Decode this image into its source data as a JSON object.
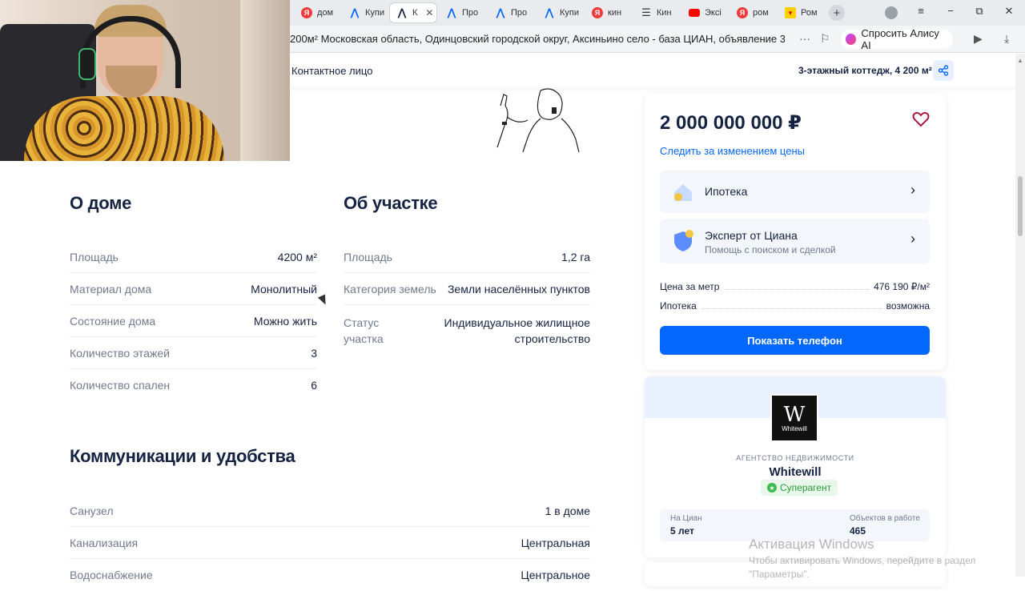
{
  "browser": {
    "tabs": [
      {
        "label": "дом",
        "icon": "yandex-icon"
      },
      {
        "label": "Купи",
        "icon": "cian-icon"
      },
      {
        "label": "К",
        "icon": "cian-icon",
        "active": true
      },
      {
        "label": "Про",
        "icon": "cian-icon"
      },
      {
        "label": "Про",
        "icon": "cian-icon"
      },
      {
        "label": "Купи",
        "icon": "cian-icon"
      },
      {
        "label": "кин",
        "icon": "yandex-icon"
      },
      {
        "label": "Кин",
        "icon": "menu-icon"
      },
      {
        "label": "Эксі",
        "icon": "youtube-icon"
      },
      {
        "label": "ром",
        "icon": "yandex-icon"
      },
      {
        "label": "Ром",
        "icon": "rom-icon"
      }
    ],
    "address": "200м² Московская область, Одинцовский городской округ, Аксиньино село - база ЦИАН, объявление 3...",
    "alice_label": "Спросить Алису AI"
  },
  "subheader": {
    "contact": "Контактное лицо",
    "title": "3-этажный коттедж, 4 200 м²"
  },
  "house": {
    "heading": "О доме",
    "rows": [
      {
        "k": "Площадь",
        "v": "4200 м²"
      },
      {
        "k": "Материал дома",
        "v": "Монолитный"
      },
      {
        "k": "Состояние дома",
        "v": "Можно жить"
      },
      {
        "k": "Количество этажей",
        "v": "3"
      },
      {
        "k": "Количество спален",
        "v": "6"
      }
    ]
  },
  "plot": {
    "heading": "Об участке",
    "rows": [
      {
        "k": "Площадь",
        "v": "1,2 га"
      },
      {
        "k": "Категория земель",
        "v": "Земли населённых пунктов"
      },
      {
        "k": "Статус участка",
        "v": "Индивидуальное жилищное строительство"
      }
    ]
  },
  "communications": {
    "heading": "Коммуникации и удобства",
    "rows": [
      {
        "k": "Санузел",
        "v": "1 в доме"
      },
      {
        "k": "Канализация",
        "v": "Центральная"
      },
      {
        "k": "Водоснабжение",
        "v": "Центральное"
      }
    ]
  },
  "offer": {
    "price": "2 000 000 000 ₽",
    "follow_price": "Следить за изменением цены",
    "mortgage_label": "Ипотека",
    "expert_label": "Эксперт от Циана",
    "expert_sub": "Помощь с поиском и сделкой",
    "price_per_m_label": "Цена за метр",
    "price_per_m_value": "476 190 ₽/м²",
    "mortgage_kv_label": "Ипотека",
    "mortgage_kv_value": "возможна",
    "show_phone": "Показать телефон"
  },
  "agency": {
    "logo_letter": "W",
    "logo_name": "Whitewill",
    "type": "АГЕНТСТВО НЕДВИЖИМОСТИ",
    "name": "Whitewill",
    "badge": "Суперагент",
    "on_cian_label": "На Циан",
    "on_cian_value": "5 лет",
    "objects_label": "Объектов в работе",
    "objects_value": "465"
  },
  "windows": {
    "line1": "Активация Windows",
    "line2": "Чтобы активировать Windows, перейдите в раздел",
    "line3": "\"Параметры\"."
  },
  "colors": {
    "accent": "#0468ff",
    "text": "#152242",
    "muted": "#707a8d",
    "heart": "#a8193a",
    "superagent": "#2c9b3c"
  }
}
